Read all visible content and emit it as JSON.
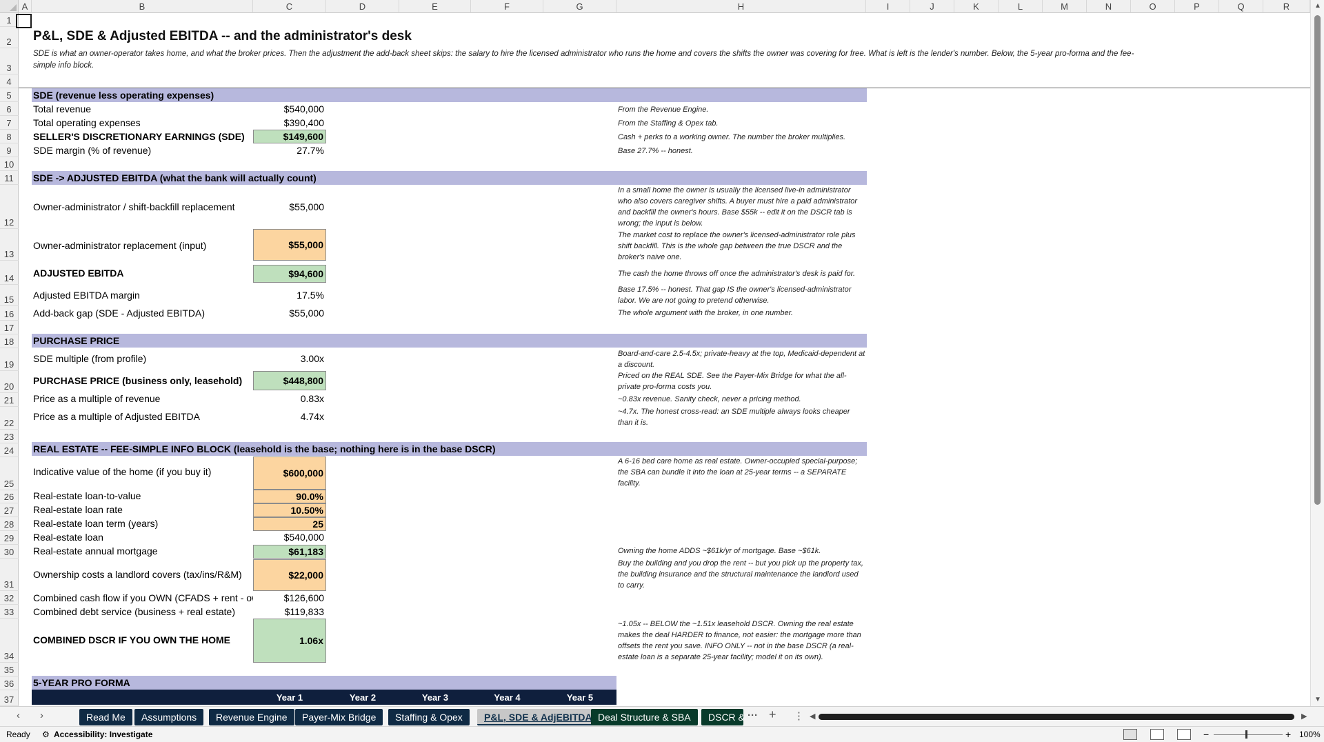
{
  "sheet": {
    "columns": [
      "A",
      "B",
      "C",
      "D",
      "E",
      "F",
      "G",
      "H",
      "I",
      "J",
      "K",
      "L",
      "M",
      "N",
      "O",
      "P",
      "Q",
      "R"
    ],
    "rows": [
      "1",
      "2",
      "3",
      "4",
      "5",
      "6",
      "7",
      "8",
      "9",
      "10",
      "11",
      "12",
      "13",
      "14",
      "15",
      "16",
      "17",
      "18",
      "19",
      "20",
      "21",
      "22",
      "23",
      "24",
      "25",
      "26",
      "27",
      "28",
      "29",
      "30",
      "31",
      "32",
      "33",
      "34",
      "35",
      "36",
      "37"
    ]
  },
  "title": "P&L, SDE & Adjusted EBITDA -- and the administrator's desk",
  "subtitle": "SDE is what an owner-operator takes home, and what the broker prices. Then the adjustment the add-back sheet skips: the salary to hire the licensed administrator who runs the home and covers the shifts the owner was covering for free. What is left is the lender's number. Below, the 5-year pro-forma and the fee-simple info block.",
  "sections": {
    "sde": {
      "header": "SDE  (revenue less operating expenses)",
      "rows": [
        {
          "label": "Total revenue",
          "value": "$540,000",
          "note": "From the Revenue Engine."
        },
        {
          "label": "Total operating expenses",
          "value": "$390,400",
          "note": "From the Staffing & Opex tab."
        },
        {
          "label": "SELLER'S DISCRETIONARY EARNINGS (SDE)",
          "value": "$149,600",
          "note": "Cash + perks to a working owner. The number the broker multiplies."
        },
        {
          "label": "SDE margin (% of revenue)",
          "value": "27.7%",
          "note": "Base 27.7% -- honest."
        }
      ]
    },
    "ebitda": {
      "header": "SDE -> ADJUSTED EBITDA  (what the bank will actually count)",
      "rows": [
        {
          "label": "Owner-administrator / shift-backfill replacement",
          "value": "$55,000",
          "note": "In a small home the owner is usually the licensed live-in administrator who also covers caregiver shifts. A buyer must hire a paid administrator and backfill the owner's hours. Base $55k -- edit it on the DSCR tab is wrong; the input is below."
        },
        {
          "label": "Owner-administrator replacement (input)",
          "value": "$55,000",
          "note": "The market cost to replace the owner's licensed-administrator role plus shift backfill. This is the whole gap between the true DSCR and the broker's naive one."
        },
        {
          "label": "ADJUSTED EBITDA",
          "value": "$94,600",
          "note": "The cash the home throws off once the administrator's desk is paid for."
        },
        {
          "label": "Adjusted EBITDA margin",
          "value": "17.5%",
          "note": "Base 17.5% -- honest. That gap IS the owner's licensed-administrator labor. We are not going to pretend otherwise."
        },
        {
          "label": "Add-back gap (SDE - Adjusted EBITDA)",
          "value": "$55,000",
          "note": "The whole argument with the broker, in one number."
        }
      ]
    },
    "price": {
      "header": "PURCHASE PRICE",
      "rows": [
        {
          "label": "SDE multiple (from profile)",
          "value": "3.00x",
          "note": "Board-and-care 2.5-4.5x; private-heavy at the top, Medicaid-dependent at a discount."
        },
        {
          "label": "PURCHASE PRICE (business only, leasehold)",
          "value": "$448,800",
          "note": "Priced on the REAL SDE. See the Payer-Mix Bridge for what the all-private pro-forma costs you."
        },
        {
          "label": "Price as a multiple of revenue",
          "value": "0.83x",
          "note": "~0.83x revenue. Sanity check, never a pricing method."
        },
        {
          "label": "Price as a multiple of Adjusted EBITDA",
          "value": "4.74x",
          "note": "~4.7x. The honest cross-read: an SDE multiple always looks cheaper than it is."
        }
      ]
    },
    "realestate": {
      "header": "REAL ESTATE -- FEE-SIMPLE INFO BLOCK  (leasehold is the base; nothing here is in the base DSCR)",
      "rows": [
        {
          "label": "Indicative value of the home (if you buy it)",
          "value": "$600,000",
          "note": "A 6-16 bed care home as real estate. Owner-occupied special-purpose; the SBA can bundle it into the loan at 25-year terms -- a SEPARATE facility."
        },
        {
          "label": "Real-estate loan-to-value",
          "value": "90.0%"
        },
        {
          "label": "Real-estate loan rate",
          "value": "10.50%"
        },
        {
          "label": "Real-estate loan term (years)",
          "value": "25"
        },
        {
          "label": "Real-estate loan",
          "value": "$540,000"
        },
        {
          "label": "Real-estate annual mortgage",
          "value": "$61,183",
          "note": "Owning the home ADDS ~$61k/yr of mortgage. Base ~$61k."
        },
        {
          "label": "Ownership costs a landlord covers (tax/ins/R&M)",
          "value": "$22,000",
          "note": "Buy the building and you drop the rent -- but you pick up the property tax, the building insurance and the structural maintenance the landlord used to carry."
        },
        {
          "label": "Combined cash flow if you OWN (CFADS + rent - own",
          "value": "$126,600"
        },
        {
          "label": "Combined debt service (business + real estate)",
          "value": "$119,833"
        },
        {
          "label": "COMBINED DSCR IF YOU OWN THE HOME",
          "value": "1.06x",
          "note": "~1.05x -- BELOW the ~1.51x leasehold DSCR. Owning the real estate makes the deal HARDER to finance, not easier: the mortgage more than offsets the rent you save. INFO ONLY -- not in the base DSCR (a real-estate loan is a separate 25-year facility; model it on its own)."
        }
      ]
    },
    "proforma": {
      "header": "5-YEAR PRO FORMA",
      "years": [
        "Year 1",
        "Year 2",
        "Year 3",
        "Year 4",
        "Year 5"
      ]
    }
  },
  "tabs": [
    {
      "label": "Read Me"
    },
    {
      "label": "Assumptions"
    },
    {
      "label": "Revenue Engine"
    },
    {
      "label": "Payer-Mix Bridge"
    },
    {
      "label": "Staffing & Opex"
    },
    {
      "label": "P&L, SDE & AdjEBITDA"
    },
    {
      "label": "Deal Structure & SBA"
    },
    {
      "label": "DSCR &"
    }
  ],
  "status": {
    "ready": "Ready",
    "accessibility": "Accessibility: Investigate",
    "zoom": "100%"
  },
  "colors": {
    "band": "#b7b8dd",
    "input": "#fcd5a0",
    "output": "#bfe0bd",
    "tab": "#0f2a44"
  }
}
